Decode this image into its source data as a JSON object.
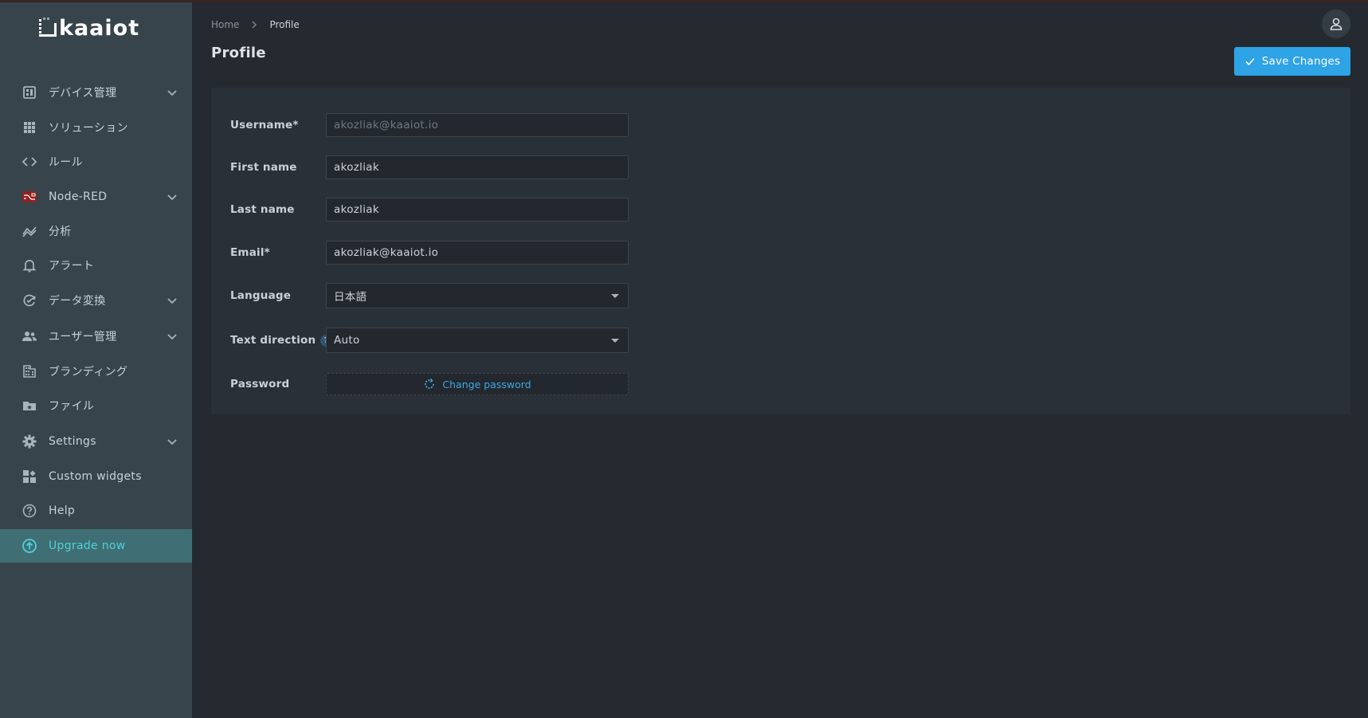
{
  "brand": {
    "logo_text": "kaaiot"
  },
  "sidebar": {
    "items": [
      {
        "label": "デバイス管理",
        "icon": "device-management-icon",
        "has_children": true
      },
      {
        "label": "ソリューション",
        "icon": "grid-icon",
        "has_children": false
      },
      {
        "label": "ルール",
        "icon": "code-icon",
        "has_children": false
      },
      {
        "label": "Node-RED",
        "icon": "node-red-icon",
        "has_children": true
      },
      {
        "label": "分析",
        "icon": "analytics-icon",
        "has_children": false
      },
      {
        "label": "アラート",
        "icon": "bell-icon",
        "has_children": false
      },
      {
        "label": "データ変換",
        "icon": "data-transform-icon",
        "has_children": true
      },
      {
        "label": "ユーザー管理",
        "icon": "users-icon",
        "has_children": true
      },
      {
        "label": "ブランディング",
        "icon": "building-icon",
        "has_children": false
      },
      {
        "label": "ファイル",
        "icon": "folder-icon",
        "has_children": false
      },
      {
        "label": "Settings",
        "icon": "gear-icon",
        "has_children": true
      },
      {
        "label": "Custom widgets",
        "icon": "widgets-icon",
        "has_children": false
      },
      {
        "label": "Help",
        "icon": "help-icon",
        "has_children": false
      },
      {
        "label": "Upgrade now",
        "icon": "upgrade-icon",
        "has_children": false,
        "active": true
      }
    ]
  },
  "breadcrumb": {
    "home": "Home",
    "current": "Profile"
  },
  "header": {
    "title": "Profile",
    "save_label": "Save Changes"
  },
  "form": {
    "username": {
      "label": "Username",
      "required_mark": "*",
      "value": "akozliak@kaaiot.io"
    },
    "first_name": {
      "label": "First name",
      "value": "akozliak"
    },
    "last_name": {
      "label": "Last name",
      "value": "akozliak"
    },
    "email": {
      "label": "Email",
      "required_mark": "*",
      "value": "akozliak@kaaiot.io"
    },
    "language": {
      "label": "Language",
      "value": "日本語"
    },
    "text_direction": {
      "label": "Text direction",
      "help": "?",
      "value": "Auto"
    },
    "password": {
      "label": "Password",
      "action_label": "Change password"
    }
  },
  "colors": {
    "accent": "#2ea3e6",
    "sidebar_bg": "#37444c",
    "active_bg": "#3f6f74",
    "active_text": "#4fd1d9"
  }
}
